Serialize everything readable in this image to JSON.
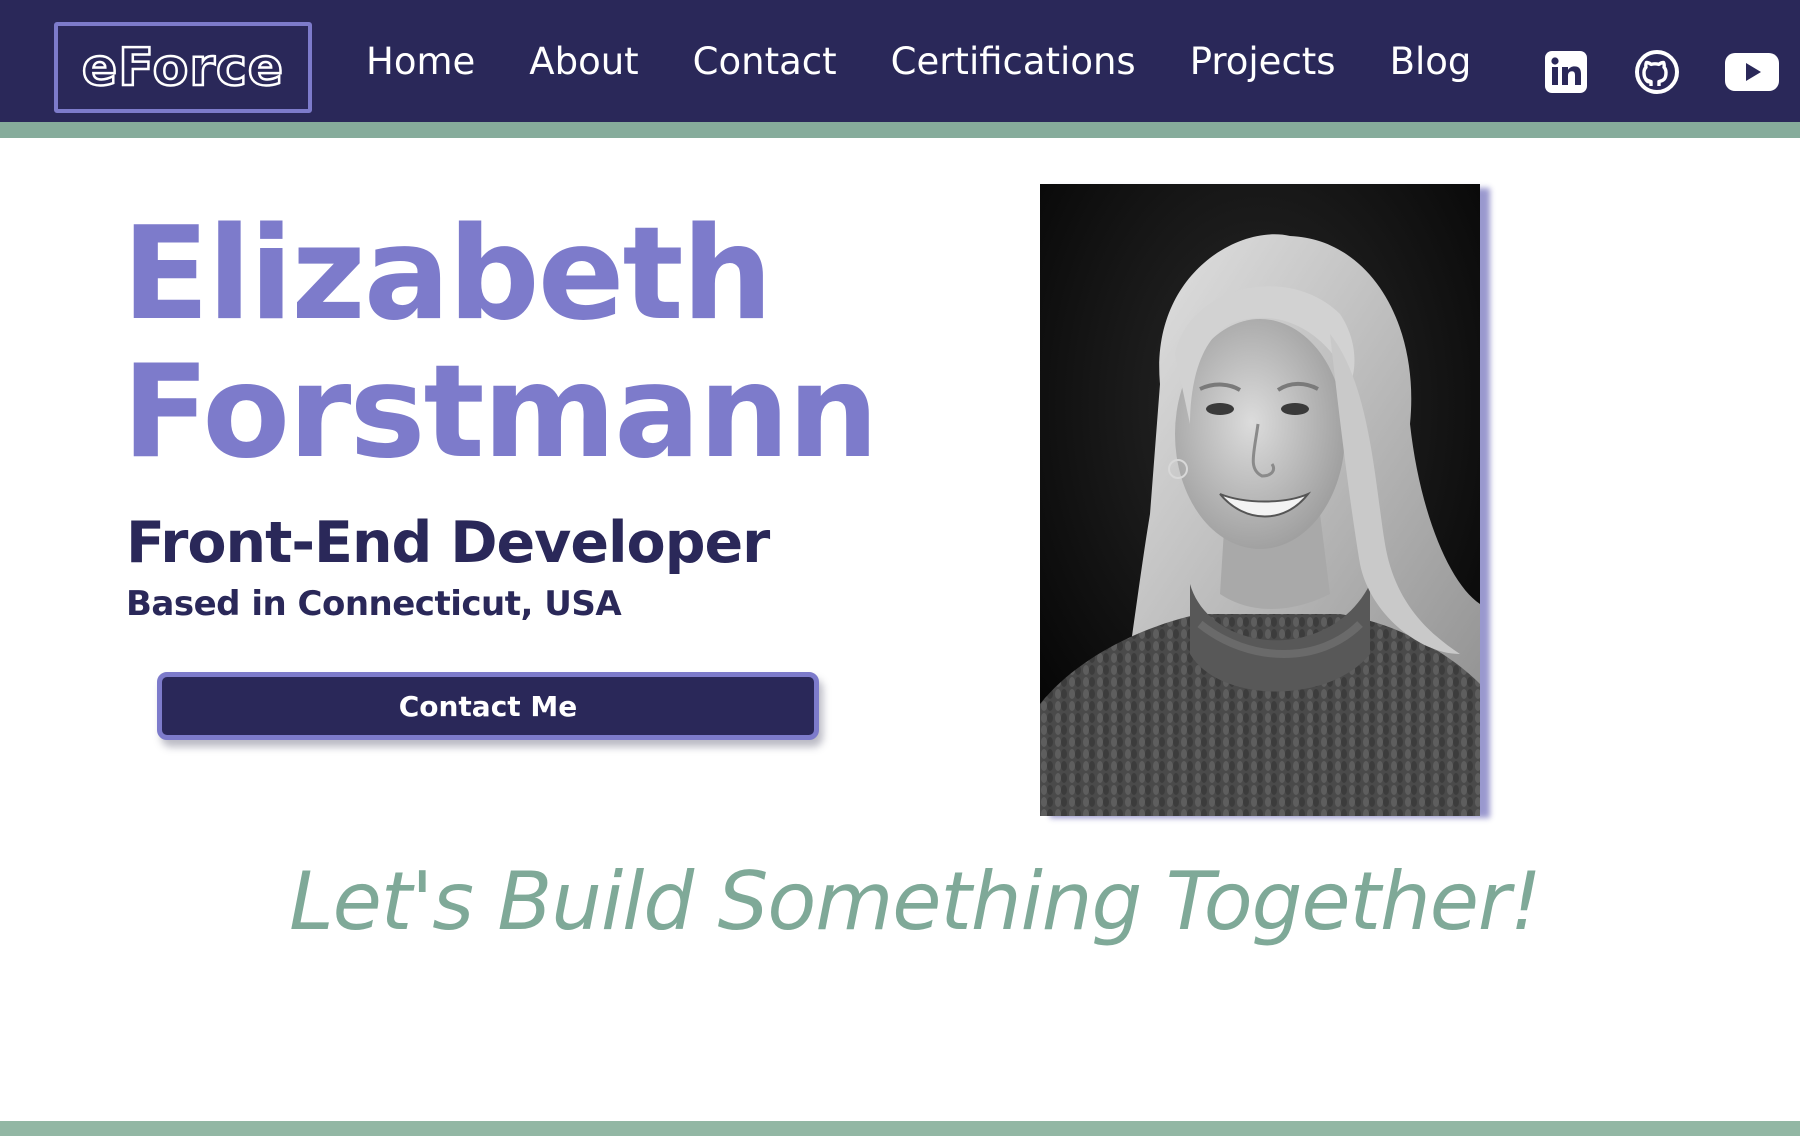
{
  "nav": {
    "logo_text": "eForce",
    "links": [
      "Home",
      "About",
      "Contact",
      "Certifications",
      "Projects",
      "Blog"
    ],
    "socials": [
      "linkedin-icon",
      "github-icon",
      "youtube-icon"
    ]
  },
  "hero": {
    "first_name": "Elizabeth",
    "last_name": "Forstmann",
    "role": "Front-End Developer",
    "location": "Based in Connecticut, USA",
    "cta_label": "Contact Me"
  },
  "tagline": "Let's Build Something Together!",
  "colors": {
    "nav_bg": "#2a2859",
    "accent_purple": "#7d7bcb",
    "accent_green": "#86ac9b"
  }
}
